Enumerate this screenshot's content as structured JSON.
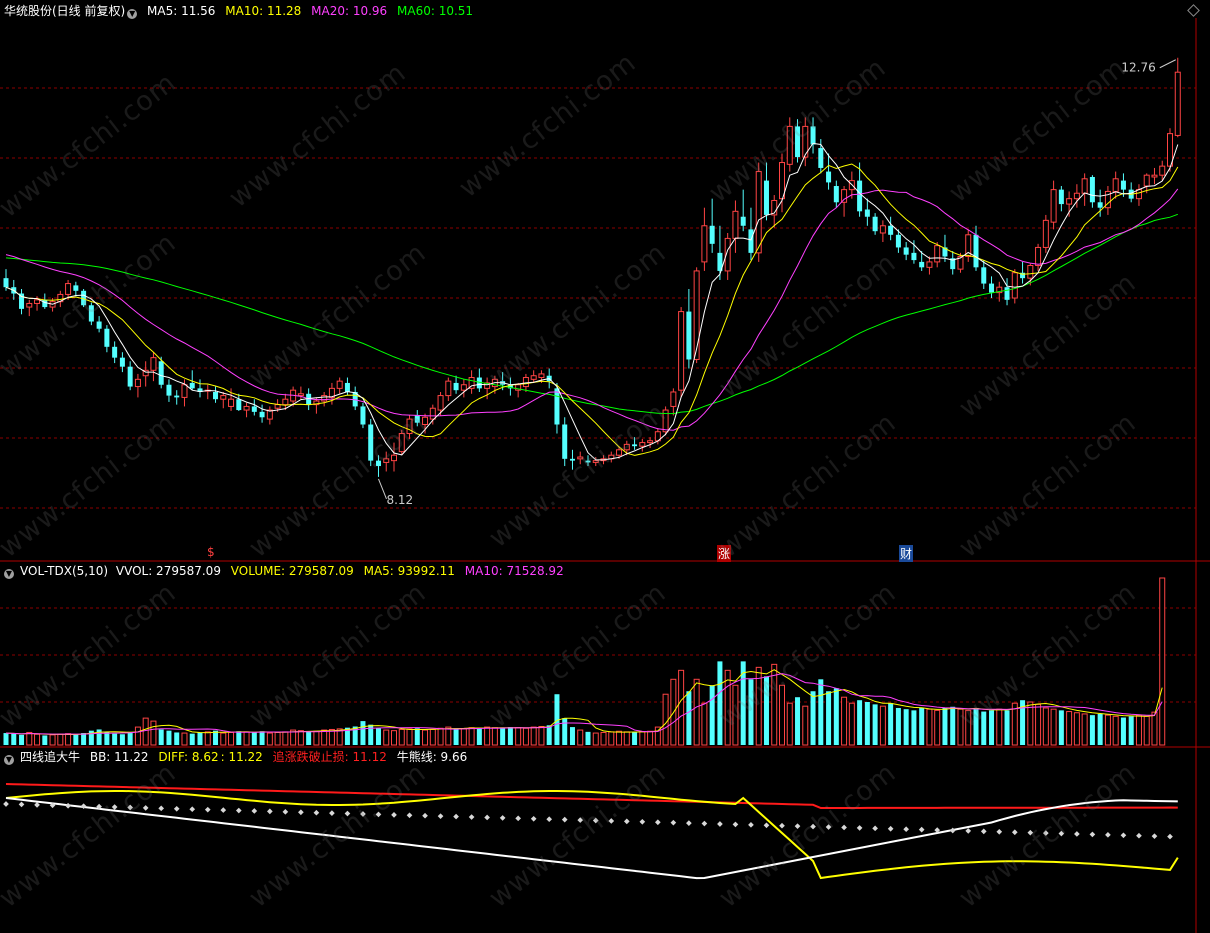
{
  "header": {
    "stock": "华统股份(日线 前复权)",
    "ma5": "MA5: 11.56",
    "ma10": "MA10: 11.28",
    "ma20": "MA20: 10.96",
    "ma60": "MA60: 10.51"
  },
  "vol_header": {
    "name": "VOL-TDX(5,10)",
    "vvol": "VVOL: 279587.09",
    "volume": "VOLUME: 279587.09",
    "ma5": "MA5: 93992.11",
    "ma10": "MA10: 71528.92"
  },
  "ind_header": {
    "name": "四线追大牛",
    "bb": "BB: 11.22",
    "diff": "DIFF: 8.62",
    "diff2": ": 11.22",
    "stop": "追涨跌破止损: 11.12",
    "bull": "牛熊线: 9.66"
  },
  "annotations": {
    "high": "12.76",
    "low": "8.12"
  },
  "markers": [
    "$",
    "涨",
    "财"
  ],
  "watermark": "www.cfchi.com",
  "colors": {
    "up": "#ff4444",
    "down": "#54ffff",
    "ma5": "#ffffff",
    "ma10": "#ffff00",
    "ma20": "#ff40ff",
    "ma60": "#00ff00",
    "grid": "#8b0000"
  },
  "chart_data": {
    "type": "candlestick",
    "price_axis_range": [
      7.2,
      13.2
    ],
    "ohlc": [
      [
        10.32,
        10.42,
        10.18,
        10.22
      ],
      [
        10.22,
        10.3,
        10.08,
        10.15
      ],
      [
        10.15,
        10.2,
        9.92,
        9.98
      ],
      [
        10.0,
        10.08,
        9.9,
        10.04
      ],
      [
        10.04,
        10.12,
        9.96,
        10.08
      ],
      [
        10.08,
        10.15,
        9.98,
        10.0
      ],
      [
        10.0,
        10.1,
        9.95,
        10.06
      ],
      [
        10.06,
        10.18,
        10.0,
        10.14
      ],
      [
        10.14,
        10.3,
        10.08,
        10.26
      ],
      [
        10.24,
        10.28,
        10.12,
        10.18
      ],
      [
        10.18,
        10.2,
        10.0,
        10.02
      ],
      [
        10.02,
        10.05,
        9.8,
        9.84
      ],
      [
        9.84,
        9.9,
        9.72,
        9.76
      ],
      [
        9.76,
        9.8,
        9.5,
        9.56
      ],
      [
        9.56,
        9.62,
        9.38,
        9.44
      ],
      [
        9.44,
        9.5,
        9.28,
        9.34
      ],
      [
        9.34,
        9.4,
        9.08,
        9.12
      ],
      [
        9.12,
        9.26,
        9.0,
        9.2
      ],
      [
        9.24,
        9.4,
        9.12,
        9.3
      ],
      [
        9.3,
        9.5,
        9.18,
        9.44
      ],
      [
        9.4,
        9.45,
        9.1,
        9.14
      ],
      [
        9.14,
        9.2,
        8.95,
        9.02
      ],
      [
        9.02,
        9.08,
        8.92,
        9.0
      ],
      [
        9.0,
        9.2,
        8.9,
        9.14
      ],
      [
        9.16,
        9.3,
        9.08,
        9.1
      ],
      [
        9.1,
        9.2,
        9.0,
        9.06
      ],
      [
        9.08,
        9.14,
        8.98,
        9.08
      ],
      [
        9.06,
        9.12,
        8.94,
        8.98
      ],
      [
        8.98,
        9.06,
        8.88,
        9.02
      ],
      [
        8.9,
        9.1,
        8.85,
        8.98
      ],
      [
        8.98,
        9.04,
        8.85,
        8.86
      ],
      [
        8.86,
        8.94,
        8.78,
        8.9
      ],
      [
        8.9,
        8.98,
        8.8,
        8.84
      ],
      [
        8.84,
        8.92,
        8.72,
        8.78
      ],
      [
        8.76,
        8.9,
        8.7,
        8.86
      ],
      [
        8.88,
        8.98,
        8.84,
        8.92
      ],
      [
        8.92,
        9.04,
        8.86,
        8.98
      ],
      [
        8.96,
        9.12,
        8.9,
        9.08
      ],
      [
        9.02,
        9.12,
        8.98,
        9.04
      ],
      [
        9.04,
        9.1,
        8.86,
        8.92
      ],
      [
        8.92,
        9.0,
        8.82,
        8.96
      ],
      [
        8.96,
        9.06,
        8.9,
        9.02
      ],
      [
        9.0,
        9.16,
        8.92,
        9.1
      ],
      [
        9.1,
        9.22,
        9.04,
        9.18
      ],
      [
        9.16,
        9.22,
        9.02,
        9.06
      ],
      [
        9.06,
        9.12,
        8.86,
        8.9
      ],
      [
        8.9,
        8.94,
        8.66,
        8.7
      ],
      [
        8.7,
        8.76,
        8.24,
        8.3
      ],
      [
        8.3,
        8.36,
        8.12,
        8.24
      ],
      [
        8.28,
        8.4,
        8.18,
        8.32
      ],
      [
        8.3,
        8.5,
        8.18,
        8.36
      ],
      [
        8.4,
        8.64,
        8.36,
        8.6
      ],
      [
        8.6,
        8.8,
        8.54,
        8.76
      ],
      [
        8.8,
        8.86,
        8.68,
        8.72
      ],
      [
        8.7,
        8.82,
        8.6,
        8.78
      ],
      [
        8.76,
        8.92,
        8.7,
        8.88
      ],
      [
        8.86,
        9.06,
        8.8,
        9.02
      ],
      [
        9.02,
        9.22,
        8.96,
        9.18
      ],
      [
        9.16,
        9.24,
        9.04,
        9.08
      ],
      [
        9.08,
        9.2,
        9.0,
        9.14
      ],
      [
        9.1,
        9.3,
        9.04,
        9.22
      ],
      [
        9.22,
        9.32,
        9.06,
        9.1
      ],
      [
        9.1,
        9.22,
        8.98,
        9.16
      ],
      [
        9.12,
        9.24,
        9.04,
        9.2
      ],
      [
        9.18,
        9.28,
        9.08,
        9.14
      ],
      [
        9.14,
        9.22,
        9.02,
        9.1
      ],
      [
        9.08,
        9.16,
        9.0,
        9.14
      ],
      [
        9.12,
        9.26,
        9.06,
        9.22
      ],
      [
        9.2,
        9.3,
        9.16,
        9.24
      ],
      [
        9.22,
        9.3,
        9.16,
        9.26
      ],
      [
        9.24,
        9.32,
        9.1,
        9.18
      ],
      [
        9.1,
        9.16,
        8.6,
        8.7
      ],
      [
        8.7,
        8.78,
        8.24,
        8.32
      ],
      [
        8.32,
        8.42,
        8.2,
        8.3
      ],
      [
        8.32,
        8.4,
        8.26,
        8.34
      ],
      [
        8.3,
        8.36,
        8.24,
        8.28
      ],
      [
        8.28,
        8.34,
        8.24,
        8.3
      ],
      [
        8.3,
        8.36,
        8.26,
        8.32
      ],
      [
        8.32,
        8.4,
        8.28,
        8.36
      ],
      [
        8.36,
        8.46,
        8.32,
        8.42
      ],
      [
        8.42,
        8.52,
        8.36,
        8.48
      ],
      [
        8.48,
        8.56,
        8.42,
        8.46
      ],
      [
        8.46,
        8.54,
        8.4,
        8.5
      ],
      [
        8.5,
        8.56,
        8.44,
        8.52
      ],
      [
        8.52,
        8.66,
        8.48,
        8.62
      ],
      [
        8.62,
        8.9,
        8.58,
        8.86
      ],
      [
        8.9,
        9.1,
        8.8,
        9.06
      ],
      [
        9.08,
        10.0,
        9.0,
        9.95
      ],
      [
        9.95,
        10.2,
        9.32,
        9.42
      ],
      [
        9.42,
        10.44,
        9.38,
        10.4
      ],
      [
        10.5,
        11.1,
        10.4,
        10.9
      ],
      [
        10.9,
        11.2,
        10.6,
        10.7
      ],
      [
        10.6,
        10.9,
        10.3,
        10.4
      ],
      [
        10.4,
        10.82,
        10.3,
        10.76
      ],
      [
        10.76,
        11.18,
        10.6,
        11.06
      ],
      [
        11.0,
        11.3,
        10.84,
        10.9
      ],
      [
        10.86,
        11.1,
        10.52,
        10.6
      ],
      [
        10.6,
        11.6,
        10.5,
        11.5
      ],
      [
        11.4,
        11.6,
        10.96,
        11.02
      ],
      [
        11.02,
        11.24,
        10.88,
        11.18
      ],
      [
        11.2,
        11.7,
        11.05,
        11.6
      ],
      [
        11.58,
        12.1,
        11.5,
        12.0
      ],
      [
        12.0,
        12.08,
        11.6,
        11.66
      ],
      [
        11.66,
        12.1,
        11.56,
        12.0
      ],
      [
        12.0,
        12.1,
        11.7,
        11.8
      ],
      [
        11.76,
        11.86,
        11.48,
        11.54
      ],
      [
        11.5,
        11.7,
        11.3,
        11.38
      ],
      [
        11.34,
        11.4,
        11.1,
        11.16
      ],
      [
        11.16,
        11.34,
        11.0,
        11.3
      ],
      [
        11.3,
        11.5,
        11.2,
        11.4
      ],
      [
        11.4,
        11.6,
        11.0,
        11.06
      ],
      [
        11.08,
        11.2,
        10.9,
        11.0
      ],
      [
        11.0,
        11.04,
        10.8,
        10.84
      ],
      [
        10.82,
        10.96,
        10.72,
        10.9
      ],
      [
        10.9,
        11.0,
        10.74,
        10.8
      ],
      [
        10.8,
        10.86,
        10.6,
        10.66
      ],
      [
        10.66,
        10.72,
        10.52,
        10.58
      ],
      [
        10.6,
        10.74,
        10.48,
        10.52
      ],
      [
        10.5,
        10.62,
        10.4,
        10.44
      ],
      [
        10.44,
        10.56,
        10.36,
        10.5
      ],
      [
        10.5,
        10.72,
        10.44,
        10.68
      ],
      [
        10.66,
        10.8,
        10.5,
        10.56
      ],
      [
        10.54,
        10.62,
        10.36,
        10.42
      ],
      [
        10.42,
        10.6,
        10.38,
        10.56
      ],
      [
        10.56,
        10.86,
        10.5,
        10.8
      ],
      [
        10.8,
        10.9,
        10.4,
        10.44
      ],
      [
        10.44,
        10.52,
        10.2,
        10.26
      ],
      [
        10.26,
        10.34,
        10.1,
        10.16
      ],
      [
        10.16,
        10.28,
        10.06,
        10.22
      ],
      [
        10.22,
        10.32,
        10.02,
        10.08
      ],
      [
        10.1,
        10.42,
        10.04,
        10.38
      ],
      [
        10.38,
        10.5,
        10.26,
        10.32
      ],
      [
        10.32,
        10.48,
        10.24,
        10.46
      ],
      [
        10.46,
        10.7,
        10.4,
        10.66
      ],
      [
        10.66,
        11.02,
        10.6,
        10.96
      ],
      [
        10.94,
        11.4,
        10.86,
        11.3
      ],
      [
        11.3,
        11.34,
        11.06,
        11.14
      ],
      [
        11.14,
        11.28,
        11.0,
        11.2
      ],
      [
        11.2,
        11.36,
        11.1,
        11.26
      ],
      [
        11.26,
        11.48,
        11.12,
        11.42
      ],
      [
        11.44,
        11.46,
        11.1,
        11.16
      ],
      [
        11.16,
        11.3,
        11.0,
        11.1
      ],
      [
        11.1,
        11.34,
        11.02,
        11.28
      ],
      [
        11.28,
        11.5,
        11.2,
        11.42
      ],
      [
        11.4,
        11.48,
        11.22,
        11.3
      ],
      [
        11.3,
        11.38,
        11.16,
        11.2
      ],
      [
        11.2,
        11.36,
        11.12,
        11.3
      ],
      [
        11.34,
        11.48,
        11.26,
        11.46
      ],
      [
        11.44,
        11.54,
        11.36,
        11.46
      ],
      [
        11.46,
        11.62,
        11.4,
        11.56
      ],
      [
        11.56,
        11.98,
        11.5,
        11.92
      ],
      [
        11.9,
        12.76,
        11.88,
        12.6
      ]
    ],
    "volume": [
      20000,
      19000,
      17000,
      21000,
      18000,
      16000,
      17000,
      18000,
      19000,
      18000,
      20000,
      24000,
      26000,
      22000,
      19000,
      18000,
      21000,
      30000,
      45000,
      40000,
      26000,
      24000,
      21000,
      20000,
      19000,
      21000,
      22000,
      24000,
      20000,
      21000,
      23000,
      22000,
      21000,
      23000,
      20000,
      21000,
      22000,
      25000,
      24000,
      22000,
      23000,
      25000,
      26000,
      27000,
      29000,
      31000,
      40000,
      34000,
      28000,
      25000,
      24000,
      26000,
      27000,
      28000,
      25000,
      26000,
      28000,
      30000,
      28000,
      27000,
      29000,
      28000,
      30000,
      29000,
      28000,
      30000,
      29000,
      28000,
      30000,
      31000,
      33000,
      85000,
      45000,
      30000,
      25000,
      22000,
      20000,
      21000,
      22000,
      23000,
      22000,
      21000,
      22000,
      23000,
      30000,
      85000,
      110000,
      125000,
      90000,
      110000,
      70000,
      100000,
      140000,
      125000,
      100000,
      140000,
      110000,
      130000,
      115000,
      135000,
      100000,
      70000,
      80000,
      65000,
      90000,
      110000,
      90000,
      95000,
      80000,
      70000,
      75000,
      72000,
      68000,
      65000,
      70000,
      62000,
      60000,
      58000,
      62000,
      60000,
      58000,
      62000,
      64000,
      60000,
      58000,
      62000,
      56000,
      58000,
      60000,
      58000,
      70000,
      75000,
      72000,
      68000,
      62000,
      60000,
      58000,
      56000,
      54000,
      52000,
      50000,
      52000,
      50000,
      48000,
      46000,
      48000,
      50000,
      48000,
      55000,
      279587
    ],
    "volume_ma5": 93992.11,
    "volume_ma10": 71528.92,
    "indicator": {
      "bb_white_final": 11.22,
      "diff_yellow_final": 8.62,
      "stop_red_final": 11.12,
      "bull_bear_dotted_final": 9.66
    }
  }
}
